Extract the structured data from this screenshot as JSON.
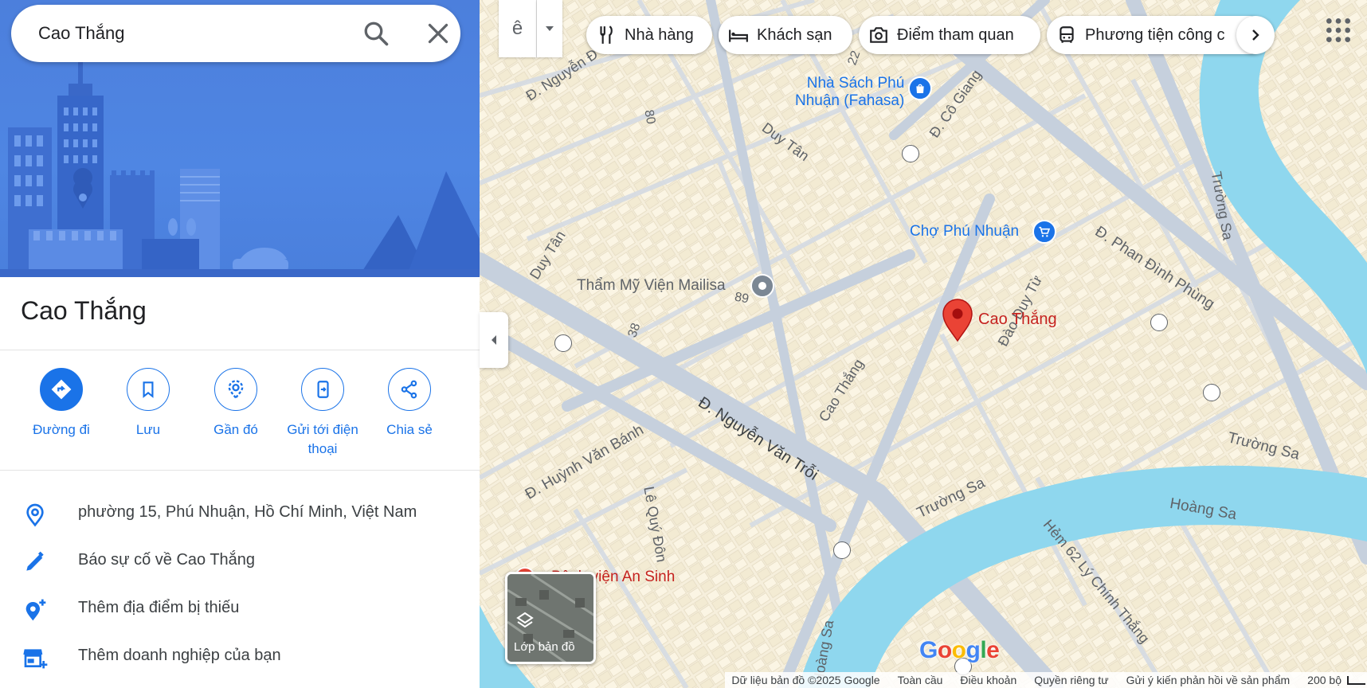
{
  "search": {
    "value": "Cao Thắng"
  },
  "place": {
    "title": "Cao Thắng"
  },
  "actions": [
    {
      "label": "Đường đi"
    },
    {
      "label": "Lưu"
    },
    {
      "label": "Gần đó"
    },
    {
      "label": "Gửi tới điện thoại"
    },
    {
      "label": "Chia sẻ"
    }
  ],
  "info_rows": [
    {
      "text": "phường 15, Phú Nhuận, Hồ Chí Minh, Việt Nam",
      "icon": "location-pin-icon"
    },
    {
      "text": "Báo sự cố về Cao Thắng",
      "icon": "pencil-icon"
    },
    {
      "text": "Thêm địa điểm bị thiếu",
      "icon": "add-location-icon"
    },
    {
      "text": "Thêm doanh nghiệp của bạn",
      "icon": "add-business-icon"
    }
  ],
  "map": {
    "lang_button": "ê",
    "chips": [
      {
        "label": "Nhà hàng",
        "icon": "fork-knife-icon"
      },
      {
        "label": "Khách sạn",
        "icon": "bed-icon"
      },
      {
        "label": "Điểm tham quan",
        "icon": "camera-icon"
      },
      {
        "label": "Phương tiện công c",
        "icon": "bus-icon"
      }
    ],
    "labels": {
      "fahasa_1": "Nhà Sách Phú",
      "fahasa_2": "Nhuận (Fahasa)",
      "market": "Chợ Phú Nhuận",
      "mailisa": "Thẩm Mỹ Viện Mailisa",
      "pin": "Cao Thắng",
      "hospital": "Bệnh viện An Sinh",
      "st_nguyen_top": "Đ. Nguyễn Đ",
      "st_duytan_a": "Duy Tân",
      "st_duytan_b": "Duy Tân",
      "st_cogiang": "Đ. Cô Giang",
      "st_phandinhphung": "Đ. Phan Đình Phùng",
      "st_truongsa_v": "Trường Sa",
      "st_truongsa_a": "Trường Sa",
      "st_truongsa_b": "Trường Sa",
      "st_hoangsa_a": "Hoàng Sa",
      "st_hoangsa_b": "Hoàng Sa",
      "st_daoduytu": "Đào Duy Từ",
      "st_caothang": "Cao Thắng",
      "st_nvt": "Đ. Nguyễn Văn Trỗi",
      "st_hvb": "Đ. Huỳnh Văn Bánh",
      "st_lqd": "Lê Quý Đôn",
      "st_hem62": "Hẻm 62 Lý Chính Thắng",
      "n80": "80",
      "n89": "89",
      "n38": "38",
      "n22": "22"
    },
    "layers_label": "Lớp bản đồ",
    "footer": {
      "data": "Dữ liệu bản đồ ©2025 Google",
      "global": "Toàn cầu",
      "terms": "Điều khoản",
      "privacy": "Quyền riêng tư",
      "feedback": "Gửi ý kiến phản hồi về sản phẩm",
      "scale": "200 bộ"
    },
    "colors": {
      "water": "#8fd7ee",
      "road": "#c9d3e0",
      "block": "#fbf3dc",
      "accent": "#1a73e8",
      "pin": "#ea4335"
    }
  }
}
